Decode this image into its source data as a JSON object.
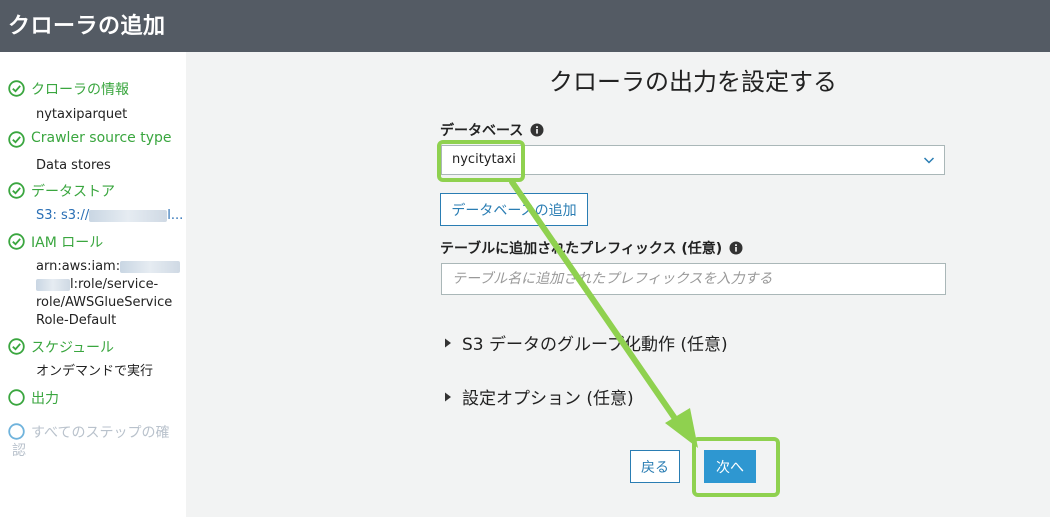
{
  "header": {
    "title": "クローラの追加"
  },
  "sidebar": {
    "steps": [
      {
        "label": "クローラの情報",
        "sub": "nytaxiparquet"
      },
      {
        "label": "Crawler source type",
        "sub": "Data stores"
      },
      {
        "label": "データストア",
        "sub": "S3: s3://",
        "sub_suffix": "l..."
      },
      {
        "label": "IAM ロール",
        "sub_lines": [
          "arn:aws:iam:",
          "l:role/service-",
          "role/AWSGlueService",
          "Role-Default"
        ]
      },
      {
        "label": "スケジュール",
        "sub": "オンデマンドで実行"
      },
      {
        "label": "出力"
      },
      {
        "label_lines": [
          "すべてのステップの確",
          "認"
        ]
      }
    ]
  },
  "main": {
    "heading": "クローラの出力を設定する",
    "database_label": "データベース",
    "database_value": "nycitytaxi",
    "add_database_button": "データベースの追加",
    "prefix_label": "テーブルに追加されたプレフィックス (任意)",
    "prefix_placeholder": "テーブル名に追加されたプレフィックスを入力する",
    "s3_grouping": "S3 データのグループ化動作 (任意)",
    "config_options": "設定オプション (任意)",
    "back_button": "戻る",
    "next_button": "次へ"
  },
  "colors": {
    "header_bg": "#545b64",
    "success": "#3aa63f",
    "primary": "#2e97d1",
    "highlight": "#8fd14f",
    "main_bg": "#f2f3f3"
  }
}
